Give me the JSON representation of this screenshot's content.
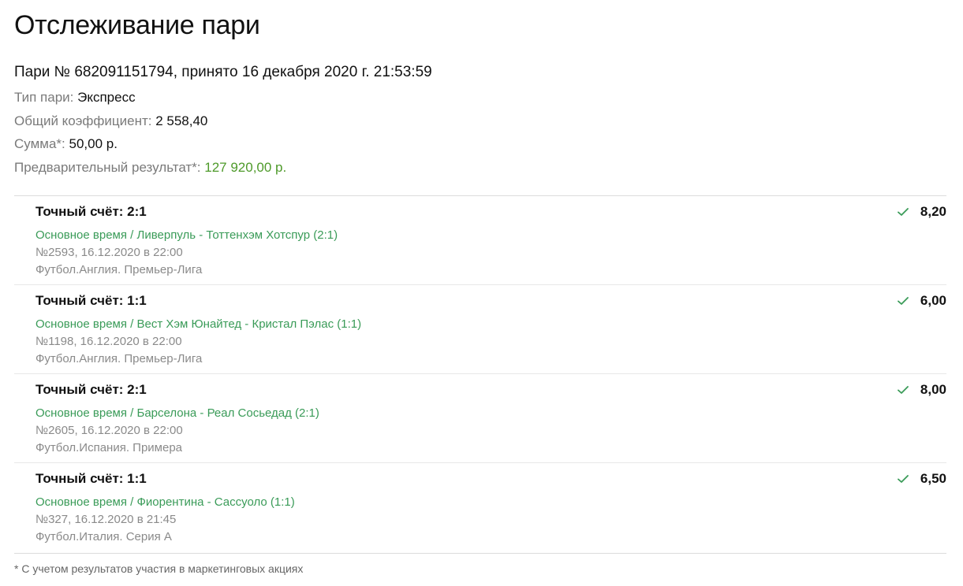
{
  "page": {
    "title": "Отслеживание пари"
  },
  "bet": {
    "header": "Пари № 682091151794, принято 16 декабря 2020 г. 21:53:59",
    "type_label": "Тип пари: ",
    "type_value": "Экспресс",
    "coef_label": "Общий коэффициент: ",
    "coef_value": "2 558,40",
    "sum_label": "Сумма*: ",
    "sum_value": "50,00 р.",
    "result_label": "Предварительный результат*: ",
    "result_value": "127 920,00 р.",
    "result_color": "#4e9a2a"
  },
  "events": [
    {
      "outcome": "Точный счёт: 2:1",
      "market": "Основное время / Ливерпуль - Тоттенхэм Хотспур (2:1)",
      "number": "№2593, 16.12.2020 в 22:00",
      "league": "Футбол.Англия. Премьер-Лига",
      "odds": "8,20",
      "status_icon": "check-icon"
    },
    {
      "outcome": "Точный счёт: 1:1",
      "market": "Основное время / Вест Хэм Юнайтед - Кристал Пэлас (1:1)",
      "number": "№1198, 16.12.2020 в 22:00",
      "league": "Футбол.Англия. Премьер-Лига",
      "odds": "6,00",
      "status_icon": "check-icon"
    },
    {
      "outcome": "Точный счёт: 2:1",
      "market": "Основное время / Барселона - Реал Сосьедад (2:1)",
      "number": "№2605, 16.12.2020 в 22:00",
      "league": "Футбол.Испания. Примера",
      "odds": "8,00",
      "status_icon": "check-icon"
    },
    {
      "outcome": "Точный счёт: 1:1",
      "market": "Основное время / Фиорентина - Сассуоло (1:1)",
      "number": "№327, 16.12.2020 в 21:45",
      "league": "Футбол.Италия. Серия А",
      "odds": "6,50",
      "status_icon": "check-icon"
    }
  ],
  "footnote": "* С учетом результатов участия в маркетинговых акциях",
  "colors": {
    "market_green": "#3a9b58",
    "check_green": "#3a9b58",
    "muted_text": "#8a8a8a"
  }
}
